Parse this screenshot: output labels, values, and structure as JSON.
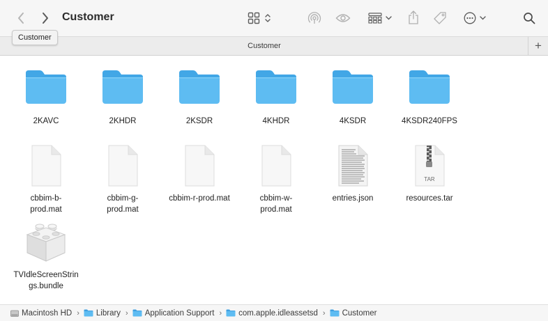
{
  "window": {
    "title": "Customer",
    "tooltip": "Customer"
  },
  "tab": {
    "title": "Customer",
    "add_label": "+"
  },
  "toolbar_icons": [
    "back-icon",
    "forward-icon",
    "grid-view-icon",
    "sort-icon",
    "airdrop-icon",
    "quick-look-icon",
    "group-icon",
    "share-icon",
    "tag-icon",
    "more-icon",
    "search-icon"
  ],
  "files": [
    {
      "name": "2KAVC",
      "kind": "folder"
    },
    {
      "name": "2KHDR",
      "kind": "folder"
    },
    {
      "name": "2KSDR",
      "kind": "folder"
    },
    {
      "name": "4KHDR",
      "kind": "folder"
    },
    {
      "name": "4KSDR",
      "kind": "folder"
    },
    {
      "name": "4KSDR240FPS",
      "kind": "folder"
    },
    {
      "name": "cbbim-b-\nprod.mat",
      "kind": "document"
    },
    {
      "name": "cbbim-g-\nprod.mat",
      "kind": "document"
    },
    {
      "name": "cbbim-r-prod.mat",
      "kind": "document"
    },
    {
      "name": "cbbim-w-\nprod.mat",
      "kind": "document"
    },
    {
      "name": "entries.json",
      "kind": "json"
    },
    {
      "name": "resources.tar",
      "kind": "archive",
      "badge": "TAR"
    },
    {
      "name": "TVIdleScreenStrin\ngs.bundle",
      "kind": "bundle"
    }
  ],
  "path": [
    {
      "label": "Macintosh HD",
      "icon": "disk-icon"
    },
    {
      "label": "Library",
      "icon": "folder-icon"
    },
    {
      "label": "Application Support",
      "icon": "folder-icon"
    },
    {
      "label": "com.apple.idleassetsd",
      "icon": "folder-icon"
    },
    {
      "label": "Customer",
      "icon": "folder-icon"
    }
  ],
  "path_separator": "›",
  "colors": {
    "folder_body": "#5ebcf2",
    "folder_tab": "#42a7e6",
    "toolbar_bg": "#f6f6f6"
  }
}
